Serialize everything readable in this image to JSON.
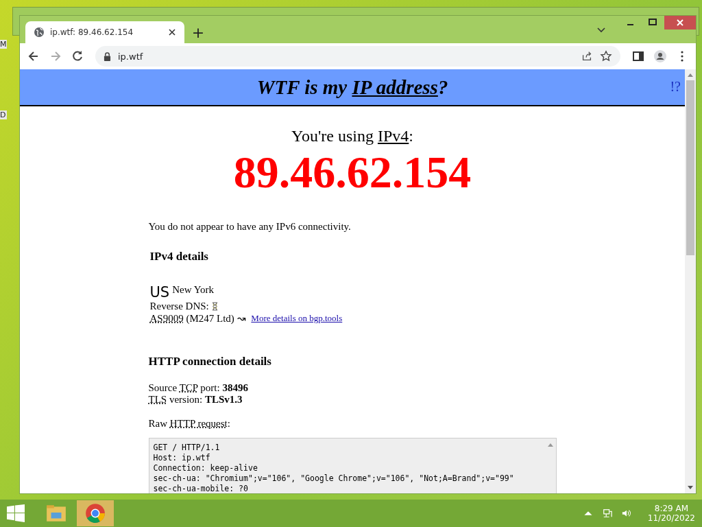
{
  "desktop": {
    "fragments": [
      "M",
      "D"
    ]
  },
  "browser": {
    "tabs": [
      {
        "title": "ip.wtf: 89.46.62.154",
        "selected": true
      }
    ],
    "new_tab": "+",
    "address": "ip.wtf"
  },
  "page": {
    "header": {
      "title_before": "WTF is my ",
      "title_link": "IP address",
      "title_after": "?",
      "help_link": "!?"
    },
    "using": {
      "before": "You're using ",
      "link": "IPv4",
      "after": ":"
    },
    "ip_address": "89.46.62.154",
    "ipv6_note": "You do not appear to have any IPv6 connectivity.",
    "ipv4": {
      "heading": "IPv4 details",
      "country": "US",
      "city": "New York",
      "reverse_dns_label": "Reverse DNS:",
      "asn_lines": [
        {
          "text": "AS9009",
          "kind": "abbr"
        },
        {
          "text": " (M247 Ltd) ↝ ",
          "kind": "plain"
        }
      ],
      "bgp_link": "More details on bgp.tools"
    },
    "http": {
      "heading": "HTTP connection details",
      "lines": [
        [
          {
            "text": "Source ",
            "kind": "plain"
          },
          {
            "text": "TCP",
            "kind": "abbr"
          },
          {
            "text": " port: ",
            "kind": "plain"
          },
          {
            "text": "38496",
            "kind": "bold"
          }
        ],
        [
          {
            "text": "TLS",
            "kind": "abbr"
          },
          {
            "text": " version: ",
            "kind": "plain"
          },
          {
            "text": "TLSv1.3",
            "kind": "bold"
          }
        ]
      ],
      "raw_label": [
        {
          "text": "Raw ",
          "kind": "plain"
        },
        {
          "text": "HTTP request",
          "kind": "abbr"
        },
        {
          "text": ":",
          "kind": "plain"
        }
      ],
      "raw_request": [
        "GET / HTTP/1.1",
        "Host: ip.wtf",
        "Connection: keep-alive",
        "sec-ch-ua: \"Chromium\";v=\"106\", \"Google Chrome\";v=\"106\", \"Not;A=Brand\";v=\"99\"",
        "sec-ch-ua-mobile: ?0"
      ]
    }
  },
  "taskbar": {
    "time": "8:29 AM",
    "date": "11/20/2022"
  }
}
